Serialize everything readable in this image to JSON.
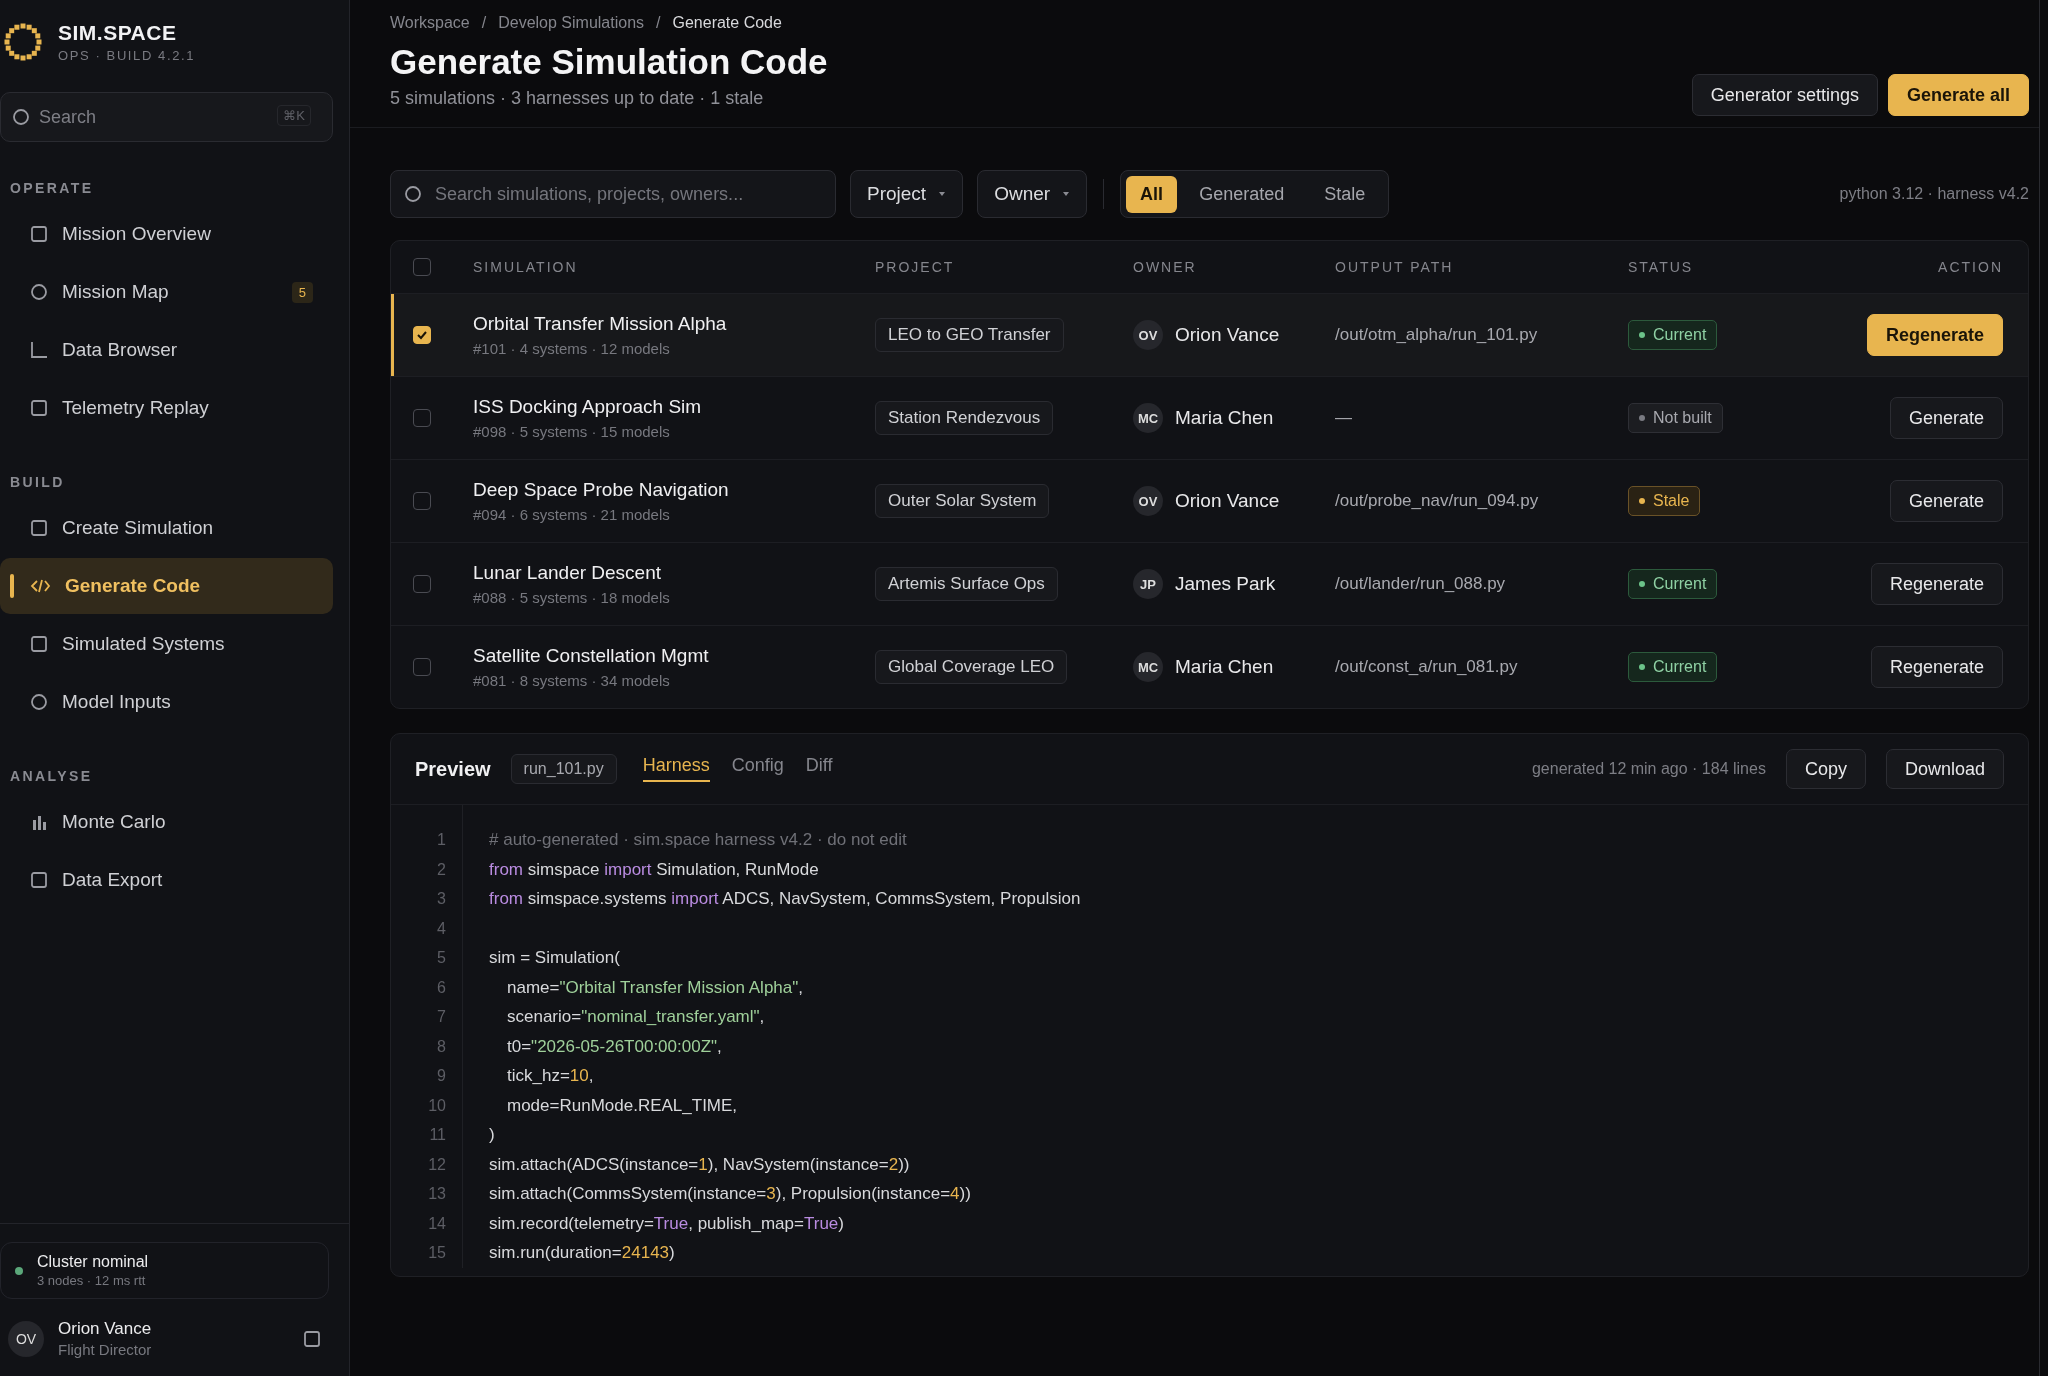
{
  "brand": {
    "name": "SIM.SPACE",
    "subtitle": "OPS · BUILD 4.2.1"
  },
  "sidebar": {
    "search": {
      "placeholder": "Search",
      "shortcut": "⌘K"
    },
    "sections": [
      {
        "title": "OPERATE",
        "items": [
          {
            "label": "Mission Overview",
            "selected": false
          },
          {
            "label": "Mission Map",
            "selected": false,
            "badge": "5"
          },
          {
            "label": "Data Browser",
            "selected": false
          },
          {
            "label": "Telemetry Replay",
            "selected": false
          }
        ]
      },
      {
        "title": "BUILD",
        "items": [
          {
            "label": "Create Simulation",
            "selected": false
          },
          {
            "label": "Generate Code",
            "selected": true
          },
          {
            "label": "Simulated Systems",
            "selected": false
          },
          {
            "label": "Model Inputs",
            "selected": false
          }
        ]
      },
      {
        "title": "ANALYSE",
        "items": [
          {
            "label": "Monte Carlo",
            "selected": false
          },
          {
            "label": "Data Export",
            "selected": false
          }
        ]
      }
    ],
    "cluster": {
      "title": "Cluster nominal",
      "detail": "3 nodes · 12 ms rtt"
    },
    "user": {
      "initials": "OV",
      "name": "Orion Vance",
      "role": "Flight Director"
    }
  },
  "breadcrumb": [
    {
      "kind": "link",
      "text": "Workspace"
    },
    {
      "kind": "sep",
      "text": "/"
    },
    {
      "kind": "link",
      "text": "Develop Simulations"
    },
    {
      "kind": "sep",
      "text": "/"
    },
    {
      "kind": "current",
      "text": "Generate Code"
    }
  ],
  "header": {
    "title": "Generate Simulation Code",
    "summary": "5 simulations · 3 harnesses up to date · 1 stale",
    "buttons": [
      {
        "label": "Generator settings",
        "kind": "secondary"
      },
      {
        "label": "Generate all",
        "kind": "primary"
      }
    ]
  },
  "filters": {
    "search": {
      "placeholder": "Search simulations, projects, owners..."
    },
    "dropdowns": [
      "Project",
      "Owner"
    ],
    "segments": [
      {
        "label": "All",
        "selected": true
      },
      {
        "label": "Generated",
        "selected": false
      },
      {
        "label": "Stale",
        "selected": false
      }
    ],
    "environment": "python 3.12 · harness v4.2"
  },
  "table": {
    "select_all": {
      "checked": false
    },
    "columns": [
      "SIMULATION",
      "PROJECT",
      "OWNER",
      "OUTPUT PATH",
      "STATUS",
      "ACTION"
    ],
    "rows": [
      {
        "selected": true,
        "name": "Orbital Transfer Mission Alpha",
        "meta": "#101 · 4 systems · 12 models",
        "project": "LEO to GEO Transfer",
        "owner_initials": "OV",
        "owner": "Orion Vance",
        "output_path": "/out/otm_alpha/run_101.py",
        "status": {
          "kind": "current",
          "label": "Current"
        },
        "action": "Regenerate"
      },
      {
        "selected": false,
        "name": "ISS Docking Approach Sim",
        "meta": "#098 · 5 systems · 15 models",
        "project": "Station Rendezvous",
        "owner_initials": "MC",
        "owner": "Maria Chen",
        "output_path": "—",
        "status": {
          "kind": "not_built",
          "label": "Not built"
        },
        "action": "Generate"
      },
      {
        "selected": false,
        "name": "Deep Space Probe Navigation",
        "meta": "#094 · 6 systems · 21 models",
        "project": "Outer Solar System",
        "owner_initials": "OV",
        "owner": "Orion Vance",
        "output_path": "/out/probe_nav/run_094.py",
        "status": {
          "kind": "stale",
          "label": "Stale"
        },
        "action": "Generate"
      },
      {
        "selected": false,
        "name": "Lunar Lander Descent",
        "meta": "#088 · 5 systems · 18 models",
        "project": "Artemis Surface Ops",
        "owner_initials": "JP",
        "owner": "James Park",
        "output_path": "/out/lander/run_088.py",
        "status": {
          "kind": "current",
          "label": "Current"
        },
        "action": "Regenerate"
      },
      {
        "selected": false,
        "name": "Satellite Constellation Mgmt",
        "meta": "#081 · 8 systems · 34 models",
        "project": "Global Coverage LEO",
        "owner_initials": "MC",
        "owner": "Maria Chen",
        "output_path": "/out/const_a/run_081.py",
        "status": {
          "kind": "current",
          "label": "Current"
        },
        "action": "Regenerate"
      }
    ]
  },
  "preview": {
    "title": "Preview",
    "file": "run_101.py",
    "tabs": [
      {
        "label": "Harness",
        "selected": true
      },
      {
        "label": "Config",
        "selected": false
      },
      {
        "label": "Diff",
        "selected": false
      }
    ],
    "info": "generated 12 min ago · 184 lines",
    "buttons": [
      "Copy",
      "Download"
    ],
    "lines": [
      {
        "number": "1",
        "tokens": [
          {
            "kind": "comment",
            "text": "# auto-generated · sim.space harness v4.2 · do not edit"
          }
        ]
      },
      {
        "number": "2",
        "tokens": [
          {
            "kind": "keyword",
            "text": "from"
          },
          {
            "kind": "plain",
            "text": " simspace "
          },
          {
            "kind": "keyword",
            "text": "import"
          },
          {
            "kind": "plain",
            "text": " Simulation, RunMode"
          }
        ]
      },
      {
        "number": "3",
        "tokens": [
          {
            "kind": "keyword",
            "text": "from"
          },
          {
            "kind": "plain",
            "text": " simspace.systems "
          },
          {
            "kind": "keyword",
            "text": "import"
          },
          {
            "kind": "plain",
            "text": " ADCS, NavSystem, CommsSystem, Propulsion"
          }
        ]
      },
      {
        "number": "4"
      },
      {
        "number": "5",
        "tokens": [
          {
            "kind": "plain",
            "text": "sim = Simulation("
          }
        ]
      },
      {
        "number": "6",
        "indented": true,
        "tokens": [
          {
            "kind": "plain",
            "text": "name="
          },
          {
            "kind": "string",
            "text": "\"Orbital Transfer Mission Alpha\""
          },
          {
            "kind": "plain",
            "text": ","
          }
        ]
      },
      {
        "number": "7",
        "indented": true,
        "tokens": [
          {
            "kind": "plain",
            "text": "scenario="
          },
          {
            "kind": "string",
            "text": "\"nominal_transfer.yaml\""
          },
          {
            "kind": "plain",
            "text": ","
          }
        ]
      },
      {
        "number": "8",
        "indented": true,
        "tokens": [
          {
            "kind": "plain",
            "text": "t0="
          },
          {
            "kind": "string",
            "text": "\"2026-05-26T00:00:00Z\""
          },
          {
            "kind": "plain",
            "text": ","
          }
        ]
      },
      {
        "number": "9",
        "indented": true,
        "tokens": [
          {
            "kind": "plain",
            "text": "tick_hz="
          },
          {
            "kind": "number",
            "text": "10"
          },
          {
            "kind": "plain",
            "text": ","
          }
        ]
      },
      {
        "number": "10",
        "indented": true,
        "tokens": [
          {
            "kind": "plain",
            "text": "mode=RunMode.REAL_TIME,"
          }
        ]
      },
      {
        "number": "11",
        "tokens": [
          {
            "kind": "plain",
            "text": ")"
          }
        ]
      },
      {
        "number": "12",
        "tokens": [
          {
            "kind": "plain",
            "text": "sim.attach(ADCS(instance="
          },
          {
            "kind": "number",
            "text": "1"
          },
          {
            "kind": "plain",
            "text": "), NavSystem(instance="
          },
          {
            "kind": "number",
            "text": "2"
          },
          {
            "kind": "plain",
            "text": "))"
          }
        ]
      },
      {
        "number": "13",
        "tokens": [
          {
            "kind": "plain",
            "text": "sim.attach(CommsSystem(instance="
          },
          {
            "kind": "number",
            "text": "3"
          },
          {
            "kind": "plain",
            "text": "), Propulsion(instance="
          },
          {
            "kind": "number",
            "text": "4"
          },
          {
            "kind": "plain",
            "text": "))"
          }
        ]
      },
      {
        "number": "14",
        "tokens": [
          {
            "kind": "plain",
            "text": "sim.record(telemetry="
          },
          {
            "kind": "keyword",
            "text": "True"
          },
          {
            "kind": "plain",
            "text": ", publish_map="
          },
          {
            "kind": "keyword",
            "text": "True"
          },
          {
            "kind": "plain",
            "text": ")"
          }
        ]
      },
      {
        "number": "15",
        "tokens": [
          {
            "kind": "plain",
            "text": "sim.run(duration="
          },
          {
            "kind": "number",
            "text": "24143"
          },
          {
            "kind": "plain",
            "text": ")"
          }
        ]
      }
    ]
  }
}
